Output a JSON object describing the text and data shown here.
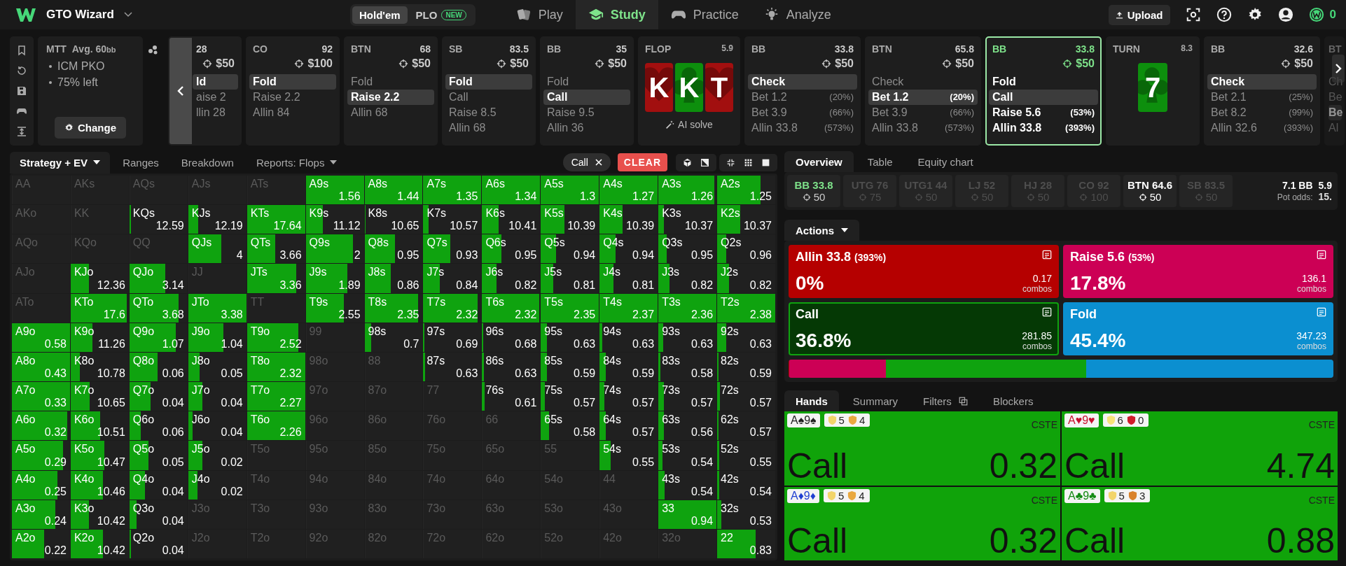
{
  "top_bar": {
    "brand": "GTO Wizard",
    "modes": [
      {
        "label": "Hold'em",
        "selected": true
      },
      {
        "label": "PLO",
        "badge": "NEW",
        "selected": false
      }
    ],
    "nav": [
      {
        "label": "Play",
        "selected": false
      },
      {
        "label": "Study",
        "selected": true
      },
      {
        "label": "Practice",
        "selected": false
      },
      {
        "label": "Analyze",
        "selected": false
      }
    ],
    "upload": "Upload",
    "coins": "0"
  },
  "strip": {
    "tournament": {
      "format": "MTT",
      "stack": "Avg. 60",
      "stack_unit": "bb",
      "details": [
        "ICM PKO",
        "75% left"
      ],
      "button": "Change"
    },
    "nodes": [
      {
        "kind": "player",
        "stack": "28",
        "bounty": "$50",
        "current": false,
        "actions": [
          {
            "label": "ld",
            "selected": true
          },
          {
            "label": "aise 2",
            "selected": false
          },
          {
            "label": "llin 28",
            "selected": false
          }
        ]
      },
      {
        "kind": "player",
        "position": "CO",
        "stack": "92",
        "bounty": "$100",
        "current": false,
        "actions": [
          {
            "label": "Fold",
            "selected": true
          },
          {
            "label": "Raise 2.2",
            "selected": false
          },
          {
            "label": "Allin 84",
            "selected": false
          }
        ]
      },
      {
        "kind": "player",
        "position": "BTN",
        "stack": "68",
        "bounty": "$50",
        "current": false,
        "actions": [
          {
            "label": "Fold",
            "selected": false
          },
          {
            "label": "Raise 2.2",
            "selected": true
          },
          {
            "label": "Allin 68",
            "selected": false
          }
        ]
      },
      {
        "kind": "player",
        "position": "SB",
        "stack": "83.5",
        "bounty": "$50",
        "current": false,
        "actions": [
          {
            "label": "Fold",
            "selected": true
          },
          {
            "label": "Call",
            "selected": false
          },
          {
            "label": "Raise 8.5",
            "selected": false
          },
          {
            "label": "Allin 68",
            "selected": false
          }
        ]
      },
      {
        "kind": "player",
        "position": "BB",
        "stack": "35",
        "bounty": "$50",
        "current": false,
        "actions": [
          {
            "label": "Fold",
            "selected": false
          },
          {
            "label": "Call",
            "selected": true
          },
          {
            "label": "Raise 9.5",
            "selected": false
          },
          {
            "label": "Allin 36",
            "selected": false
          }
        ]
      },
      {
        "kind": "board",
        "street": "FLOP",
        "pot": "5.9",
        "cards": [
          {
            "rank": "K",
            "kind": "heart",
            "color": "#a20f0f"
          },
          {
            "rank": "K",
            "kind": "club",
            "color": "#0d8f0d"
          },
          {
            "rank": "T",
            "kind": "heart",
            "color": "#a20f0f"
          }
        ],
        "link": "AI solve"
      },
      {
        "kind": "player",
        "position": "BB",
        "stack": "33.8",
        "bounty": "$50",
        "current": false,
        "actions": [
          {
            "label": "Check",
            "selected": true
          },
          {
            "label": "Bet 1.2",
            "pct": "(20%)",
            "selected": false
          },
          {
            "label": "Bet 3.9",
            "pct": "(66%)",
            "selected": false
          },
          {
            "label": "Allin 33.8",
            "pct": "(573%)",
            "selected": false
          }
        ]
      },
      {
        "kind": "player",
        "position": "BTN",
        "stack": "65.8",
        "bounty": "$50",
        "current": false,
        "actions": [
          {
            "label": "Check",
            "selected": false
          },
          {
            "label": "Bet 1.2",
            "pct": "(20%)",
            "selected": true
          },
          {
            "label": "Bet 3.9",
            "pct": "(66%)",
            "selected": false
          },
          {
            "label": "Allin 33.8",
            "pct": "(573%)",
            "selected": false
          }
        ]
      },
      {
        "kind": "player",
        "position": "BB",
        "stack": "33.8",
        "bounty": "$50",
        "current": true,
        "actions": [
          {
            "label": "Fold",
            "selected": false
          },
          {
            "label": "Call",
            "selected": true
          },
          {
            "label": "Raise 5.6",
            "pct": "(53%)",
            "selected": false
          },
          {
            "label": "Allin 33.8",
            "pct": "(393%)",
            "selected": false
          }
        ]
      },
      {
        "kind": "board",
        "street": "TURN",
        "pot": "8.3",
        "cards": [
          {
            "rank": "7",
            "kind": "club",
            "color": "#0d8f0d"
          }
        ]
      },
      {
        "kind": "player",
        "position": "BB",
        "stack": "32.6",
        "bounty": "$50",
        "current": false,
        "actions": [
          {
            "label": "Check",
            "selected": true
          },
          {
            "label": "Bet 2.1",
            "pct": "(25%)",
            "selected": false
          },
          {
            "label": "Bet 8.2",
            "pct": "(99%)",
            "selected": false
          },
          {
            "label": "Allin 32.6",
            "pct": "(393%)",
            "selected": false
          }
        ]
      },
      {
        "kind": "player",
        "position": "BT",
        "faded": true,
        "current": false,
        "actions": [
          {
            "label": "Ch",
            "selected": false
          },
          {
            "label": "Be",
            "selected": false
          },
          {
            "label": "Be",
            "selected": true
          },
          {
            "label": "Al",
            "selected": false
          }
        ]
      }
    ]
  },
  "strategy_panel": {
    "tabs": [
      {
        "label": "Strategy + EV",
        "dropdown": true,
        "selected": true
      },
      {
        "label": "Ranges",
        "dropdown": false,
        "selected": false
      },
      {
        "label": "Breakdown",
        "dropdown": false,
        "selected": false
      },
      {
        "label": "Reports: Flops",
        "dropdown": true,
        "selected": false
      }
    ],
    "filter_chip": "Call",
    "clear": "CLEAR",
    "grid": {
      "rows": [
        {
          "cells": [
            {
              "hand": "AA",
              "level": 0
            },
            {
              "hand": "AKs",
              "level": 0
            },
            {
              "hand": "AQs",
              "level": 0
            },
            {
              "hand": "AJs",
              "level": 0
            },
            {
              "hand": "ATs",
              "level": 0
            },
            {
              "hand": "A9s",
              "value": "1.56",
              "level": 1
            },
            {
              "hand": "A8s",
              "value": "1.44",
              "level": 1
            },
            {
              "hand": "A7s",
              "value": "1.35",
              "level": 1
            },
            {
              "hand": "A6s",
              "value": "1.34",
              "level": 1
            },
            {
              "hand": "A5s",
              "value": "1.3",
              "level": 1
            },
            {
              "hand": "A4s",
              "value": "1.27",
              "level": 1
            },
            {
              "hand": "A3s",
              "value": "1.26",
              "level": 0.96
            },
            {
              "hand": "A2s",
              "value": "1.25",
              "level": 0.75
            }
          ]
        },
        {
          "cells": [
            {
              "hand": "AKo",
              "level": 0
            },
            {
              "hand": "KK",
              "level": 0
            },
            {
              "hand": "KQs",
              "value": "12.59",
              "level": 0.02
            },
            {
              "hand": "KJs",
              "value": "12.19",
              "level": 0.17
            },
            {
              "hand": "KTs",
              "value": "17.64",
              "level": 1
            },
            {
              "hand": "K9s",
              "value": "11.12",
              "level": 0.29
            },
            {
              "hand": "K8s",
              "value": "10.65",
              "level": 0.02
            },
            {
              "hand": "K7s",
              "value": "10.57",
              "level": 0.09
            },
            {
              "hand": "K6s",
              "value": "10.41",
              "level": 0.28
            },
            {
              "hand": "K5s",
              "value": "10.39",
              "level": 0.41
            },
            {
              "hand": "K4s",
              "value": "10.39",
              "level": 0.4
            },
            {
              "hand": "K3s",
              "value": "10.37",
              "level": 0.1
            },
            {
              "hand": "K2s",
              "value": "10.37",
              "level": 0.4
            }
          ]
        },
        {
          "cells": [
            {
              "hand": "AQo",
              "level": 0
            },
            {
              "hand": "KQo",
              "level": 0
            },
            {
              "hand": "QQ",
              "level": 0
            },
            {
              "hand": "QJs",
              "value": "4",
              "level": 0.57
            },
            {
              "hand": "QTs",
              "value": "3.66",
              "level": 0.49
            },
            {
              "hand": "Q9s",
              "value": "2",
              "level": 0.81
            },
            {
              "hand": "Q8s",
              "value": "0.95",
              "level": 0.52
            },
            {
              "hand": "Q7s",
              "value": "0.93",
              "level": 0.46
            },
            {
              "hand": "Q6s",
              "value": "0.95",
              "level": 0.33
            },
            {
              "hand": "Q5s",
              "value": "0.94",
              "level": 0.26
            },
            {
              "hand": "Q4s",
              "value": "0.94",
              "level": 0.28
            },
            {
              "hand": "Q3s",
              "value": "0.95",
              "level": 0.14
            },
            {
              "hand": "Q2s",
              "value": "0.96",
              "level": 0.16
            }
          ]
        },
        {
          "cells": [
            {
              "hand": "AJo",
              "level": 0
            },
            {
              "hand": "KJo",
              "value": "12.36",
              "level": 0.32
            },
            {
              "hand": "QJo",
              "value": "3.14",
              "level": 0.62
            },
            {
              "hand": "JJ",
              "level": 0
            },
            {
              "hand": "JTs",
              "value": "3.36",
              "level": 0.85
            },
            {
              "hand": "J9s",
              "value": "1.89",
              "level": 0.72
            },
            {
              "hand": "J8s",
              "value": "0.86",
              "level": 0.45
            },
            {
              "hand": "J7s",
              "value": "0.84",
              "level": 0.28
            },
            {
              "hand": "J6s",
              "value": "0.82",
              "level": 0.25
            },
            {
              "hand": "J5s",
              "value": "0.81",
              "level": 0.21
            },
            {
              "hand": "J4s",
              "value": "0.81",
              "level": 0.24
            },
            {
              "hand": "J3s",
              "value": "0.82",
              "level": 0.19
            },
            {
              "hand": "J2s",
              "value": "0.82",
              "level": 0.2
            }
          ]
        },
        {
          "cells": [
            {
              "hand": "ATo",
              "level": 0
            },
            {
              "hand": "KTo",
              "value": "17.6",
              "level": 0.97
            },
            {
              "hand": "QTo",
              "value": "3.68",
              "level": 0.85
            },
            {
              "hand": "JTo",
              "value": "3.38",
              "level": 1
            },
            {
              "hand": "TT",
              "level": 0
            },
            {
              "hand": "T9s",
              "value": "2.55",
              "level": 0.65
            },
            {
              "hand": "T8s",
              "value": "2.35",
              "level": 0.92
            },
            {
              "hand": "T7s",
              "value": "2.32",
              "level": 0.94
            },
            {
              "hand": "T6s",
              "value": "2.32",
              "level": 0.98
            },
            {
              "hand": "T5s",
              "value": "2.35",
              "level": 1
            },
            {
              "hand": "T4s",
              "value": "2.37",
              "level": 1
            },
            {
              "hand": "T3s",
              "value": "2.36",
              "level": 1
            },
            {
              "hand": "T2s",
              "value": "2.38",
              "level": 1
            }
          ]
        },
        {
          "cells": [
            {
              "hand": "A9o",
              "value": "0.58",
              "level": 1
            },
            {
              "hand": "K9o",
              "value": "11.26",
              "level": 0.37
            },
            {
              "hand": "Q9o",
              "value": "1.07",
              "level": 0.8
            },
            {
              "hand": "J9o",
              "value": "1.04",
              "level": 0.6
            },
            {
              "hand": "T9o",
              "value": "2.52",
              "level": 0.88
            },
            {
              "hand": "99",
              "level": 0
            },
            {
              "hand": "98s",
              "value": "0.7",
              "level": 0.12
            },
            {
              "hand": "97s",
              "value": "0.69",
              "level": 0.02
            },
            {
              "hand": "96s",
              "value": "0.68",
              "level": 0.02
            },
            {
              "hand": "95s",
              "value": "0.63",
              "level": 0.11
            },
            {
              "hand": "94s",
              "value": "0.63",
              "level": 0.05
            },
            {
              "hand": "93s",
              "value": "0.63",
              "level": 0.08
            },
            {
              "hand": "92s",
              "value": "0.63",
              "level": 0.16
            }
          ]
        },
        {
          "cells": [
            {
              "hand": "A8o",
              "value": "0.43",
              "level": 1
            },
            {
              "hand": "K8o",
              "value": "10.78",
              "level": 0.16
            },
            {
              "hand": "Q8o",
              "value": "0.06",
              "level": 0.48
            },
            {
              "hand": "J8o",
              "value": "0.05",
              "level": 0.19
            },
            {
              "hand": "T8o",
              "value": "2.32",
              "level": 1
            },
            {
              "hand": "98o",
              "level": 0
            },
            {
              "hand": "88",
              "level": 0
            },
            {
              "hand": "87s",
              "value": "0.63",
              "level": 0.03
            },
            {
              "hand": "86s",
              "value": "0.63",
              "level": 0.03
            },
            {
              "hand": "85s",
              "value": "0.59",
              "level": 0.11
            },
            {
              "hand": "84s",
              "value": "0.59",
              "level": 0.1
            },
            {
              "hand": "83s",
              "value": "0.58",
              "level": 0.04
            },
            {
              "hand": "82s",
              "value": "0.59",
              "level": 0.02
            }
          ]
        },
        {
          "cells": [
            {
              "hand": "A7o",
              "value": "0.33",
              "level": 1
            },
            {
              "hand": "K7o",
              "value": "10.65",
              "level": 0.33
            },
            {
              "hand": "Q7o",
              "value": "0.04",
              "level": 0.36
            },
            {
              "hand": "J7o",
              "value": "0.04",
              "level": 0.24
            },
            {
              "hand": "T7o",
              "value": "2.27",
              "level": 1
            },
            {
              "hand": "97o",
              "level": 0
            },
            {
              "hand": "87o",
              "level": 0
            },
            {
              "hand": "77",
              "level": 0
            },
            {
              "hand": "76s",
              "value": "0.61",
              "level": 0.04
            },
            {
              "hand": "75s",
              "value": "0.57",
              "level": 0.07
            },
            {
              "hand": "74s",
              "value": "0.57",
              "level": 0.08
            },
            {
              "hand": "73s",
              "value": "0.57",
              "level": 0.09
            },
            {
              "hand": "72s",
              "value": "0.57",
              "level": 0.05
            }
          ]
        },
        {
          "cells": [
            {
              "hand": "A6o",
              "value": "0.32",
              "level": 0.95
            },
            {
              "hand": "K6o",
              "value": "10.51",
              "level": 0.51
            },
            {
              "hand": "Q6o",
              "value": "0.06",
              "level": 0.2
            },
            {
              "hand": "J6o",
              "value": "0.04",
              "level": 0.08
            },
            {
              "hand": "T6o",
              "value": "2.26",
              "level": 1
            },
            {
              "hand": "96o",
              "level": 0
            },
            {
              "hand": "86o",
              "level": 0
            },
            {
              "hand": "76o",
              "level": 0
            },
            {
              "hand": "66",
              "level": 0
            },
            {
              "hand": "65s",
              "value": "0.58",
              "level": 0.14
            },
            {
              "hand": "64s",
              "value": "0.57",
              "level": 0.1
            },
            {
              "hand": "63s",
              "value": "0.56",
              "level": 0.09
            },
            {
              "hand": "62s",
              "value": "0.57",
              "level": 0.02
            }
          ]
        },
        {
          "cells": [
            {
              "hand": "A5o",
              "value": "0.29",
              "level": 0.88
            },
            {
              "hand": "K5o",
              "value": "10.47",
              "level": 0.58
            },
            {
              "hand": "Q5o",
              "value": "0.05",
              "level": 0.33
            },
            {
              "hand": "J5o",
              "value": "0.02",
              "level": 0.24
            },
            {
              "hand": "T5o",
              "level": 0
            },
            {
              "hand": "95o",
              "level": 0
            },
            {
              "hand": "85o",
              "level": 0
            },
            {
              "hand": "75o",
              "level": 0
            },
            {
              "hand": "65o",
              "level": 0
            },
            {
              "hand": "55",
              "level": 0
            },
            {
              "hand": "54s",
              "value": "0.55",
              "level": 0.19
            },
            {
              "hand": "53s",
              "value": "0.54",
              "level": 0.07
            },
            {
              "hand": "52s",
              "value": "0.55",
              "level": 0.04
            }
          ]
        },
        {
          "cells": [
            {
              "hand": "A4o",
              "value": "0.25",
              "level": 0.78
            },
            {
              "hand": "K4o",
              "value": "10.46",
              "level": 0.55
            },
            {
              "hand": "Q4o",
              "value": "0.04",
              "level": 0.27
            },
            {
              "hand": "J4o",
              "value": "0.02",
              "level": 0.16
            },
            {
              "hand": "T4o",
              "level": 0
            },
            {
              "hand": "94o",
              "level": 0
            },
            {
              "hand": "84o",
              "level": 0
            },
            {
              "hand": "74o",
              "level": 0
            },
            {
              "hand": "64o",
              "level": 0
            },
            {
              "hand": "54o",
              "level": 0
            },
            {
              "hand": "44",
              "level": 0
            },
            {
              "hand": "43s",
              "value": "0.54",
              "level": 0.11
            },
            {
              "hand": "42s",
              "value": "0.54",
              "level": 0.03
            }
          ]
        },
        {
          "cells": [
            {
              "hand": "A3o",
              "value": "0.24",
              "level": 0.75
            },
            {
              "hand": "K3o",
              "value": "10.42",
              "level": 0.32
            },
            {
              "hand": "Q3o",
              "value": "0.04",
              "level": 0.12
            },
            {
              "hand": "J3o",
              "level": 0
            },
            {
              "hand": "T3o",
              "level": 0
            },
            {
              "hand": "93o",
              "level": 0
            },
            {
              "hand": "83o",
              "level": 0
            },
            {
              "hand": "73o",
              "level": 0
            },
            {
              "hand": "63o",
              "level": 0
            },
            {
              "hand": "53o",
              "level": 0
            },
            {
              "hand": "43o",
              "level": 0
            },
            {
              "hand": "33",
              "value": "0.94",
              "level": 1
            },
            {
              "hand": "32s",
              "value": "0.53",
              "level": 0.07
            }
          ]
        },
        {
          "cells": [
            {
              "hand": "A2o",
              "value": "0.22",
              "level": 0.55
            },
            {
              "hand": "K2o",
              "value": "10.42",
              "level": 0.55
            },
            {
              "hand": "Q2o",
              "value": "0.04",
              "level": 0.03
            },
            {
              "hand": "J2o",
              "level": 0
            },
            {
              "hand": "T2o",
              "level": 0
            },
            {
              "hand": "92o",
              "level": 0
            },
            {
              "hand": "82o",
              "level": 0
            },
            {
              "hand": "72o",
              "level": 0
            },
            {
              "hand": "62o",
              "level": 0
            },
            {
              "hand": "52o",
              "level": 0
            },
            {
              "hand": "42o",
              "level": 0
            },
            {
              "hand": "32o",
              "level": 0
            },
            {
              "hand": "22",
              "value": "0.83",
              "level": 0.66
            }
          ]
        }
      ]
    }
  },
  "overview_panel": {
    "tabs": [
      {
        "label": "Overview",
        "selected": true
      },
      {
        "label": "Table",
        "selected": false
      },
      {
        "label": "Equity chart",
        "selected": false
      }
    ],
    "players": [
      {
        "label": "BB 33.8",
        "bounty": "50",
        "selected": true,
        "folded": false
      },
      {
        "label": "UTG 76",
        "bounty": "75",
        "selected": false,
        "folded": true
      },
      {
        "label": "UTG1 44",
        "bounty": "50",
        "selected": false,
        "folded": true
      },
      {
        "label": "LJ 52",
        "bounty": "50",
        "selected": false,
        "folded": true
      },
      {
        "label": "HJ 28",
        "bounty": "50",
        "selected": false,
        "folded": true
      },
      {
        "label": "CO 92",
        "bounty": "100",
        "selected": false,
        "folded": true
      },
      {
        "label": "BTN 64.6",
        "bounty": "50",
        "selected": false,
        "folded": false
      },
      {
        "label": "SB 83.5",
        "bounty": "50",
        "selected": false,
        "folded": true
      }
    ],
    "pot": {
      "main": "7.1 BB",
      "side": "5.9",
      "odds_label": "Pot odds:",
      "odds": "15."
    },
    "actions_tab": "Actions",
    "actions": [
      {
        "name": "Allin 33.8",
        "pct": "(393%)",
        "frequency": "0%",
        "combos": "0.17",
        "unit": "combos",
        "color": "#b50000",
        "level": 0,
        "selected": false
      },
      {
        "name": "Raise 5.6",
        "pct": "(53%)",
        "frequency": "17.8%",
        "combos": "136.1",
        "unit": "combos",
        "color": "#cc0055",
        "level": 0.178,
        "selected": false
      },
      {
        "name": "Call",
        "frequency": "36.8%",
        "combos": "281.85",
        "unit": "combos",
        "color": "#0fa30f",
        "level": 0.368,
        "selected": true
      },
      {
        "name": "Fold",
        "frequency": "45.4%",
        "combos": "347.23",
        "unit": "combos",
        "color": "#0b8fd0",
        "level": 0.454,
        "selected": false
      }
    ],
    "hands_tabs": [
      {
        "label": "Hands",
        "selected": true
      },
      {
        "label": "Summary",
        "selected": false
      },
      {
        "label": "Filters",
        "selected": false
      },
      {
        "label": "Blockers",
        "selected": false
      }
    ],
    "hands": [
      {
        "cards": "A♠9♠",
        "color": "#222222",
        "badges": [
          {
            "value": "5",
            "color": "#f2d46b"
          },
          {
            "value": "4",
            "color": "#e9a840"
          }
        ],
        "tag": "CSTE",
        "action": "Call",
        "value": "0.32"
      },
      {
        "cards": "A♥9♥",
        "color": "#c8102e",
        "badges": [
          {
            "value": "6",
            "color": "#f7e27a"
          },
          {
            "value": "0",
            "color": "#d01c2a"
          }
        ],
        "tag": "CSTE",
        "action": "Call",
        "value": "4.74"
      },
      {
        "cards": "A♦9♦",
        "color": "#1f3fd1",
        "badges": [
          {
            "value": "5",
            "color": "#f2d46b"
          },
          {
            "value": "4",
            "color": "#e9a840"
          }
        ],
        "tag": "CSTE",
        "action": "Call",
        "value": "0.32"
      },
      {
        "cards": "A♣9♣",
        "color": "#138a13",
        "badges": [
          {
            "value": "5",
            "color": "#f2d46b"
          },
          {
            "value": "3",
            "color": "#d9822b"
          }
        ],
        "tag": "CSTE",
        "action": "Call",
        "value": "0.88"
      }
    ]
  }
}
